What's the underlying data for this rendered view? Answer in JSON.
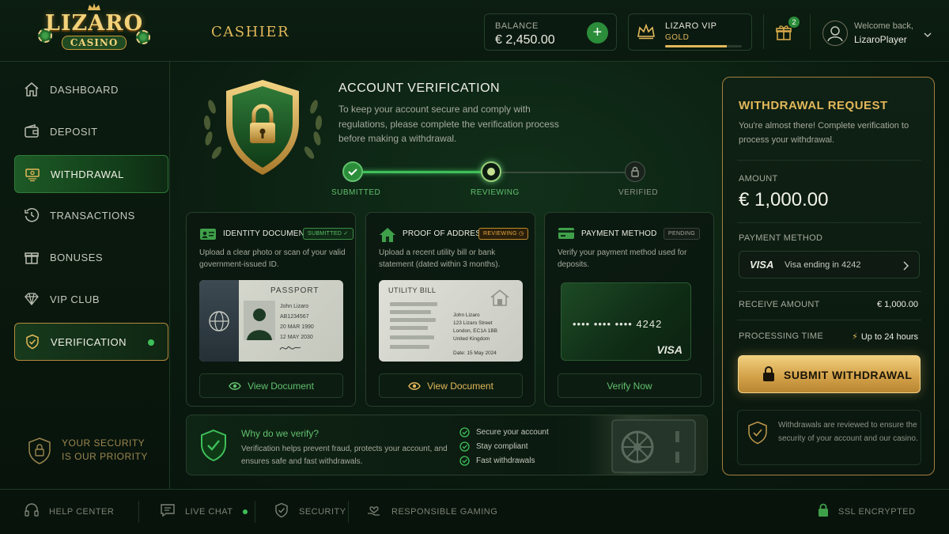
{
  "brand": {
    "name_line1": "LIZARO",
    "name_line2": "CASINO"
  },
  "header": {
    "page_title": "CASHIER",
    "balance_label": "BALANCE",
    "balance_value": "€ 2,450.00",
    "add_funds_symbol": "+",
    "vip_label": "LIZARO VIP",
    "vip_tier": "GOLD",
    "vip_progress": 0.8,
    "gift_count": "2",
    "welcome_text": "Welcome back,",
    "username": "LizaroPlayer"
  },
  "sidebar": {
    "items": [
      {
        "label": "DASHBOARD",
        "icon": "home-icon"
      },
      {
        "label": "DEPOSIT",
        "icon": "wallet-icon"
      },
      {
        "label": "WITHDRAWAL",
        "icon": "cash-icon",
        "active": true
      },
      {
        "label": "TRANSACTIONS",
        "icon": "history-icon"
      },
      {
        "label": "BONUSES",
        "icon": "gift-icon"
      },
      {
        "label": "VIP CLUB",
        "icon": "diamond-icon"
      },
      {
        "label": "VERIFICATION",
        "icon": "shield-check-icon",
        "active": true
      }
    ],
    "security_line1": "YOUR SECURITY",
    "security_line2": "IS OUR PRIORITY"
  },
  "verification": {
    "title": "ACCOUNT VERIFICATION",
    "description": "To keep your account secure and comply with regulations, please complete the verification process before making a withdrawal.",
    "steps": [
      {
        "label": "SUBMITTED",
        "state": "done"
      },
      {
        "label": "REVIEWING",
        "state": "current"
      },
      {
        "label": "VERIFIED",
        "state": "locked"
      }
    ]
  },
  "cards": {
    "identity": {
      "title": "IDENTITY DOCUMENT",
      "status": "SUBMITTED",
      "description": "Upload a clear photo or scan of your valid government-issued ID.",
      "doc_title": "PASSPORT",
      "doc_lines": [
        "John Lizaro",
        "AB1234567",
        "20 MAR 1990",
        "12 MAY 2030"
      ],
      "action": "View Document"
    },
    "address": {
      "title": "PROOF OF ADDRESS",
      "status": "REVIEWING",
      "description": "Upload a recent utility bill or bank statement (dated within 3 months).",
      "doc_title": "UTILITY BILL",
      "doc_lines": [
        "John Lizaro",
        "123 Lizaro Street",
        "London, EC1A 1BB",
        "United Kingdom"
      ],
      "doc_date": "Date: 15 May 2024",
      "action": "View Document"
    },
    "payment": {
      "title": "PAYMENT METHOD",
      "status": "PENDING",
      "description": "Verify your payment method used for deposits.",
      "card_number": "•••• •••• •••• 4242",
      "card_brand": "VISA",
      "action": "Verify Now"
    }
  },
  "why": {
    "title": "Why do we verify?",
    "description": "Verification helps prevent fraud, protects your account, and ensures safe and fast withdrawals.",
    "benefits": [
      "Secure your account",
      "Stay compliant",
      "Fast withdrawals"
    ]
  },
  "withdrawal": {
    "title": "WITHDRAWAL REQUEST",
    "subtitle": "You're almost there! Complete verification to process your withdrawal.",
    "amount_label": "AMOUNT",
    "amount_value": "€ 1,000.00",
    "payment_method_label": "PAYMENT METHOD",
    "payment_brand": "VISA",
    "payment_text": "Visa ending in 4242",
    "receive_label": "RECEIVE AMOUNT",
    "receive_value": "€ 1,000.00",
    "processing_label": "PROCESSING TIME",
    "processing_value": "Up to 24 hours",
    "submit_label": "SUBMIT WITHDRAWAL",
    "note": "Withdrawals are reviewed to ensure the security of your account and our casino."
  },
  "footer": {
    "help": "HELP CENTER",
    "chat": "LIVE CHAT",
    "security": "SECURITY",
    "responsible": "RESPONSIBLE GAMING",
    "ssl": "SSL ENCRYPTED"
  },
  "colors": {
    "accent_green": "#3fbf5a",
    "accent_gold": "#e2b85a",
    "background": "#0a1a0f"
  }
}
